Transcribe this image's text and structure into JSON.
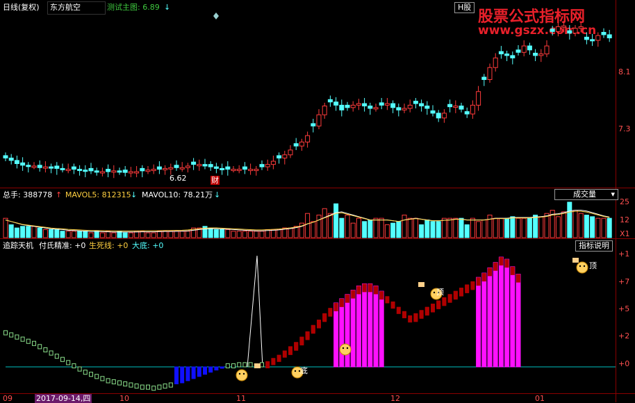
{
  "header": {
    "chart_label": "日线(复权)",
    "stock_name": "东方航空",
    "indicator": "测试主图: 6.89",
    "indicator_arrow": "↓",
    "period_tag": "H股",
    "watermark_title": "股票公式指标网",
    "watermark_url": "www.gszx.com.cn"
  },
  "price_panel": {
    "y_ticks": [
      "8.1",
      "7.3"
    ],
    "low_label": "6.62",
    "finance_mark": "财"
  },
  "volume_panel": {
    "total_label": "总手: 388778",
    "total_arrow": "↑",
    "ma5_label": "MAVOL5: 812315",
    "ma5_arrow": "↓",
    "ma10_label": "MAVOL10: 78.21万",
    "ma10_arrow": "↓",
    "dropdown_label": "成交量",
    "y_ticks": [
      "25",
      "12",
      "X1"
    ]
  },
  "indicator_panel": {
    "title": "追踪天机",
    "items": [
      "付氏精准: +0",
      "生死线: +0",
      "大底: +0"
    ],
    "button_label": "指标说明",
    "y_ticks": [
      "+1",
      "+7",
      "+5",
      "+2",
      "+0"
    ],
    "label_top": "顶",
    "label_bottom": "底"
  },
  "x_axis": {
    "labels": [
      "09",
      "10",
      "11",
      "12",
      "01"
    ],
    "selected_date": "2017-09-14,四"
  },
  "colors": {
    "background": "#000000",
    "up": "#ff3b3b",
    "down": "#54ffff",
    "magenta": "#ff10ff",
    "dark_red": "#b00000",
    "blue": "#1010ff",
    "green": "#8ce08c",
    "axis": "#8b0000",
    "baseline": "#00c0c0"
  },
  "chart_data": [
    {
      "type": "candlestick",
      "title": "东方航空 日线(复权)",
      "y_ticks": [
        8.1,
        7.3
      ],
      "annotations": [
        "6.62",
        "财"
      ],
      "series": [
        {
          "name": "close",
          "values": [
            6.8,
            6.77,
            6.73,
            6.71,
            6.7,
            6.7,
            6.68,
            6.69,
            6.68,
            6.67,
            6.66,
            6.66,
            6.66,
            6.65,
            6.64,
            6.64,
            6.63,
            6.63,
            6.63,
            6.64,
            6.63,
            6.62,
            6.63,
            6.63,
            6.64,
            6.65,
            6.66,
            6.66,
            6.67,
            6.68,
            6.68,
            6.68,
            6.7,
            6.72,
            6.72,
            6.7,
            6.69,
            6.67,
            6.66,
            6.66,
            6.66,
            6.66,
            6.66,
            6.66,
            6.66,
            6.69,
            6.72,
            6.76,
            6.8,
            6.84,
            6.9,
            6.95,
            7.0,
            7.08,
            7.2,
            7.34,
            7.45,
            7.5,
            7.46,
            7.4,
            7.43,
            7.46,
            7.48,
            7.45,
            7.42,
            7.43,
            7.46,
            7.48,
            7.43,
            7.4,
            7.42,
            7.46,
            7.48,
            7.45,
            7.42,
            7.36,
            7.3,
            7.36,
            7.44,
            7.45,
            7.41,
            7.35,
            7.46,
            7.63,
            7.78,
            7.93,
            8.05,
            8.1,
            8.08,
            8.05,
            8.12,
            8.2,
            8.15,
            8.08,
            8.1,
            8.2,
            8.38,
            8.44,
            8.45,
            8.36,
            8.42,
            8.44,
            8.28,
            8.27,
            8.33,
            8.34,
            8.3
          ]
        }
      ]
    },
    {
      "type": "bar",
      "title": "成交量",
      "series": [
        {
          "name": "总手",
          "values": [
            12,
            8,
            6,
            7,
            7,
            7,
            6,
            5,
            5,
            5,
            4,
            4,
            4,
            4,
            4,
            3,
            4,
            3,
            4,
            3,
            4,
            3,
            3,
            4,
            4,
            3,
            3,
            4,
            4,
            4,
            4,
            4,
            4,
            6,
            6,
            7,
            6,
            5,
            5,
            5,
            4,
            4,
            4,
            4,
            4,
            4,
            5,
            5,
            5,
            6,
            6,
            7,
            9,
            15,
            10,
            14,
            18,
            15,
            21,
            12,
            14,
            9,
            12,
            10,
            11,
            12,
            12,
            8,
            9,
            10,
            14,
            12,
            12,
            8,
            11,
            10,
            10,
            12,
            12,
            12,
            12,
            8,
            12,
            10,
            11,
            14,
            12,
            12,
            12,
            13,
            12,
            12,
            12,
            14,
            13,
            15,
            17,
            13,
            16,
            22,
            17,
            15,
            14,
            13,
            12,
            12,
            12
          ]
        },
        {
          "name": "MAVOL5",
          "values": [
            11,
            10,
            9,
            8,
            7.5,
            7,
            6.5,
            6,
            5.5,
            5.2,
            5,
            4.6,
            4.4,
            4.2,
            4,
            3.8,
            3.8,
            3.7,
            3.6,
            3.5,
            3.5,
            3.5,
            3.5,
            3.5,
            3.6,
            3.6,
            3.6,
            3.7,
            3.8,
            3.8,
            3.9,
            4,
            4.2,
            4.6,
            5,
            5.4,
            5.6,
            5.6,
            5.4,
            5.2,
            5,
            4.8,
            4.6,
            4.4,
            4.2,
            4.2,
            4.4,
            4.6,
            4.8,
            5.2,
            5.6,
            6.2,
            7,
            8.5,
            9.5,
            11,
            12.5,
            14,
            15.5,
            16,
            15,
            14,
            13,
            12,
            11,
            11,
            11,
            11,
            10.5,
            10,
            11,
            11.5,
            12,
            11.5,
            11,
            10.5,
            10.5,
            10.8,
            11,
            11.5,
            11.5,
            11,
            11,
            11,
            11,
            11.5,
            12,
            12,
            12,
            12.5,
            12.5,
            12.5,
            12.5,
            12.8,
            13,
            13.5,
            14.5,
            14.8,
            15.5,
            16.5,
            17,
            17,
            16.5,
            15.5,
            14.5,
            13.5,
            12.8
          ]
        }
      ]
    },
    {
      "type": "bar",
      "title": "追踪天机",
      "y_ticks": [
        "+1",
        "+7",
        "+5",
        "+2",
        "+0"
      ],
      "annotations": [
        "顶",
        "底"
      ],
      "series": [
        {
          "name": "追踪天机",
          "values": [
            3.2,
            3.0,
            2.8,
            2.6,
            2.4,
            2.2,
            1.9,
            1.6,
            1.3,
            1.0,
            0.7,
            0.4,
            0.1,
            -0.2,
            -0.5,
            -0.7,
            -0.9,
            -1.1,
            -1.3,
            -1.4,
            -1.5,
            -1.6,
            -1.7,
            -1.8,
            -1.9,
            -1.9,
            -2.0,
            -1.9,
            -1.8,
            -1.7,
            -1.6,
            -1.5,
            -1.3,
            -1.1,
            -0.9,
            -0.7,
            -0.5,
            -0.3,
            -0.1,
            0.1,
            0.1,
            0.2,
            0.2,
            0.2,
            0.1,
            0.2,
            0.5,
            0.8,
            1.1,
            1.5,
            1.9,
            2.3,
            2.8,
            3.3,
            3.9,
            4.4,
            5.0,
            5.5,
            6.0,
            6.4,
            6.8,
            7.2,
            7.6,
            7.8,
            7.8,
            7.6,
            7.1,
            6.6,
            6.1,
            5.6,
            5.2,
            4.8,
            5.0,
            5.3,
            5.6,
            5.9,
            6.2,
            6.5,
            6.8,
            7.1,
            7.4,
            7.7,
            8.0,
            8.4,
            8.8,
            9.3,
            9.8,
            10.3,
            10.1,
            9.4,
            8.7
          ]
        }
      ]
    }
  ]
}
